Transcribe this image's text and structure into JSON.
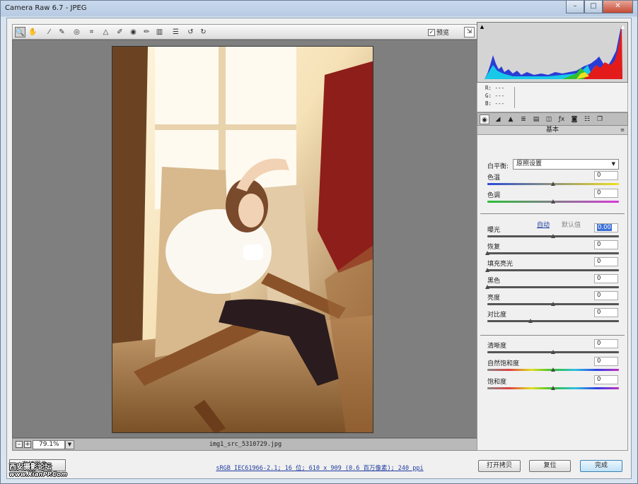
{
  "window": {
    "title": "Camera Raw 6.7 -  JPEG"
  },
  "toolbar": {
    "tools": [
      {
        "icon": "zoom-icon",
        "glyph": "🔍"
      },
      {
        "icon": "hand-icon",
        "glyph": "✋"
      },
      {
        "icon": "white-balance-icon",
        "glyph": "⁄"
      },
      {
        "icon": "color-sampler-icon",
        "glyph": "✎"
      },
      {
        "icon": "target-adjust-icon",
        "glyph": "◎"
      },
      {
        "icon": "crop-icon",
        "glyph": "⌗"
      },
      {
        "icon": "straighten-icon",
        "glyph": "△"
      },
      {
        "icon": "spot-removal-icon",
        "glyph": "✐"
      },
      {
        "icon": "red-eye-icon",
        "glyph": "◉"
      },
      {
        "icon": "adjustment-brush-icon",
        "glyph": "✏"
      },
      {
        "icon": "graduated-filter-icon",
        "glyph": "▥"
      },
      {
        "icon": "preferences-icon",
        "glyph": "☰"
      },
      {
        "icon": "rotate-ccw-icon",
        "glyph": "↺"
      },
      {
        "icon": "rotate-cw-icon",
        "glyph": "↻"
      }
    ],
    "preview_label": "预览",
    "preview_checked": "✓"
  },
  "status": {
    "zoom_value": "79.1%",
    "filename": "img1_src_5310729.jpg"
  },
  "readout": {
    "r": "R:  ---",
    "g": "G:  ---",
    "b": "B:  ---"
  },
  "panel": {
    "title": "基本",
    "white_balance_label": "白平衡:",
    "white_balance_value": "原照设置",
    "auto_label": "自动",
    "default_label": "默认值",
    "sliders": [
      {
        "label": "色温",
        "value": "0",
        "level": 0.5
      },
      {
        "label": "色调",
        "value": "0",
        "level": 0.5
      },
      {
        "label": "曝光",
        "value": "0.00",
        "level": 0.5
      },
      {
        "label": "恢复",
        "value": "0",
        "level": 0.0
      },
      {
        "label": "填充亮光",
        "value": "0",
        "level": 0.0
      },
      {
        "label": "黑色",
        "value": "0",
        "level": 0.0
      },
      {
        "label": "亮度",
        "value": "0",
        "level": 0.5
      },
      {
        "label": "对比度",
        "value": "0",
        "level": 0.33
      },
      {
        "label": "清晰度",
        "value": "0",
        "level": 0.5
      },
      {
        "label": "自然饱和度",
        "value": "0",
        "level": 0.5
      },
      {
        "label": "饱和度",
        "value": "0",
        "level": 0.5
      }
    ]
  },
  "bottom": {
    "save_label": "存储图像...",
    "workflow_text": "sRGB IEC61966-2.1; 16 位; 610 x 909 (0.6 百万像素); 240 ppi",
    "open_label": "打开拷贝",
    "reset_label": "复位",
    "done_label": "完成",
    "watermark": "西安摄影论坛",
    "watermark_url": "www.XianPP.Com"
  },
  "colors": {
    "highlight_clip": "#ffffff",
    "selection": "#3b6fd6",
    "histogram_bg": "#d4d4d4"
  }
}
